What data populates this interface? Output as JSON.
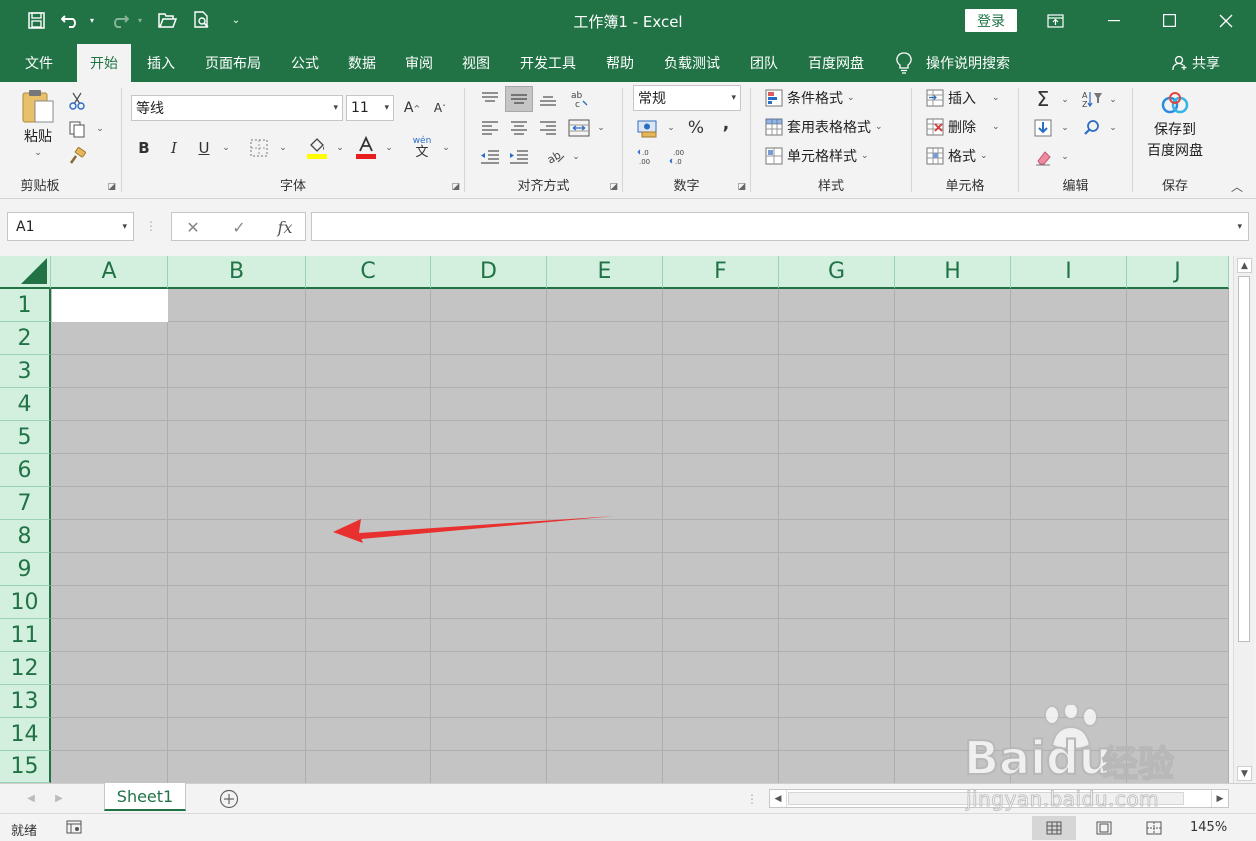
{
  "titlebar": {
    "title": "工作簿1  -  Excel",
    "login": "登录"
  },
  "tabs": [
    "文件",
    "开始",
    "插入",
    "页面布局",
    "公式",
    "数据",
    "审阅",
    "视图",
    "开发工具",
    "帮助",
    "负载测试",
    "团队",
    "百度网盘"
  ],
  "active_tab": "开始",
  "tell_me": "操作说明搜索",
  "share": "共享",
  "ribbon": {
    "clipboard": {
      "paste": "粘贴",
      "label": "剪贴板"
    },
    "font": {
      "name": "等线",
      "size": "11",
      "bold": "B",
      "italic": "I",
      "underline": "U",
      "label": "字体",
      "phonetic": "wén"
    },
    "alignment": {
      "label": "对齐方式"
    },
    "number": {
      "format": "常规",
      "percent": "%",
      "comma": ",",
      "label": "数字"
    },
    "styles": {
      "conditional": "条件格式",
      "table": "套用表格格式",
      "cell": "单元格样式",
      "label": "样式"
    },
    "cells": {
      "insert": "插入",
      "delete": "删除",
      "format": "格式",
      "label": "单元格"
    },
    "editing": {
      "label": "编辑"
    },
    "save": {
      "button_line1": "保存到",
      "button_line2": "百度网盘",
      "label": "保存"
    }
  },
  "formula_bar": {
    "name_box": "A1",
    "fx": "fx",
    "formula": ""
  },
  "grid": {
    "columns": [
      "A",
      "B",
      "C",
      "D",
      "E",
      "F",
      "G",
      "H",
      "I",
      "J"
    ],
    "rows": [
      "1",
      "2",
      "3",
      "4",
      "5",
      "6",
      "7",
      "8",
      "9",
      "10",
      "11",
      "12",
      "13",
      "14",
      "15"
    ],
    "active_cell": "A1"
  },
  "sheets": [
    "Sheet1"
  ],
  "status": {
    "ready": "就绪",
    "zoom": "145%"
  },
  "watermark": {
    "brand": "Bai",
    "brand2": "du",
    "cn": "经验",
    "url": "jingyan.baidu.com"
  },
  "colors": {
    "excel_green": "#217346",
    "header_bg": "#d3f0df",
    "grid_bg": "#c4c4c4",
    "arrow": "#e8302f"
  }
}
